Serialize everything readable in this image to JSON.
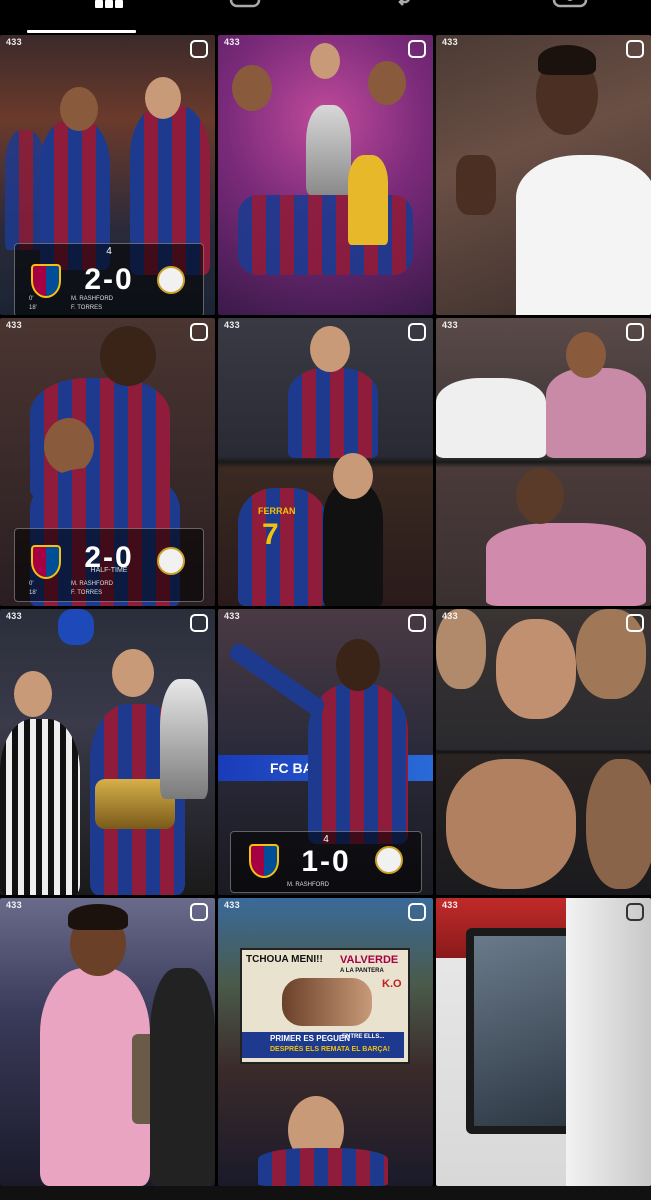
{
  "tabs": [
    {
      "name": "grid",
      "icon": "grid-icon",
      "active": true
    },
    {
      "name": "reels",
      "icon": "reels-icon",
      "active": false
    },
    {
      "name": "reposts",
      "icon": "repost-icon",
      "active": false
    },
    {
      "name": "tagged",
      "icon": "tagged-icon",
      "active": false
    }
  ],
  "brand_label": "433",
  "posts": [
    {
      "id": "p1",
      "score": "2-0",
      "minute": "4",
      "scorers": [
        "M. RASHFORD",
        "F. TORRES"
      ],
      "mins": [
        "0'",
        "18'"
      ]
    },
    {
      "id": "p2"
    },
    {
      "id": "p3"
    },
    {
      "id": "p4",
      "score": "2-0",
      "period": "HALF-TIME",
      "scorers": [
        "M. RASHFORD",
        "F. TORRES"
      ],
      "mins": [
        "0'",
        "18'"
      ]
    },
    {
      "id": "p5",
      "shirt_name": "FERRAN",
      "shirt_number": "7"
    },
    {
      "id": "p6"
    },
    {
      "id": "p7"
    },
    {
      "id": "p8",
      "score": "1-0",
      "minute": "4",
      "scorers": [
        "M. RASHFORD"
      ],
      "banner": "FC BARCELONA"
    },
    {
      "id": "p9"
    },
    {
      "id": "p10"
    },
    {
      "id": "p11",
      "poster_lines": [
        "TCHOUA MENI!!",
        "VALVERDE",
        "A LA PANTERA",
        "K.O",
        "PRIMER ES PEGUEN",
        "ENTRE ELLS...",
        "DESPRÉS ELS REMATA EL BARÇA!"
      ]
    },
    {
      "id": "p12"
    }
  ],
  "colors": {
    "fcb_blue": "#1d3a8f",
    "fcb_red": "#8e1c3a",
    "background": "#000000"
  }
}
